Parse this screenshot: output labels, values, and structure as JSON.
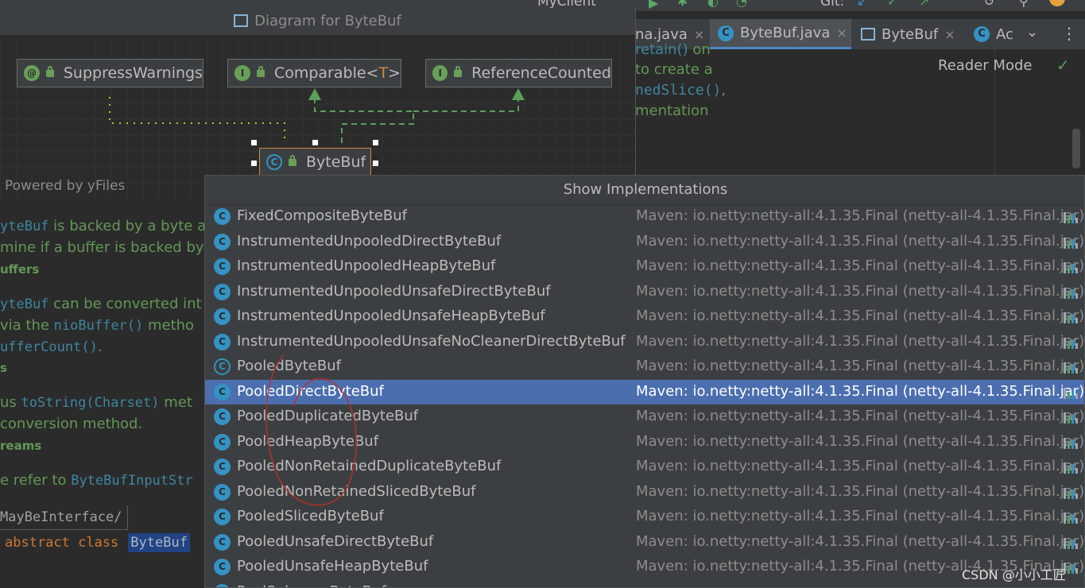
{
  "toolbar": {
    "run_config": "MyClient",
    "git_label": "Git:"
  },
  "tabs": [
    {
      "label": "na.java",
      "close": "×",
      "icon": "java-file-icon"
    },
    {
      "label": "ByteBuf.java",
      "close": "×",
      "icon": "class-icon",
      "icon_glyph": "C"
    },
    {
      "label": "ByteBuf",
      "close": "×",
      "icon": "diagram-icon"
    },
    {
      "label": "Ac",
      "icon": "class-icon",
      "icon_glyph": "C"
    }
  ],
  "editor": {
    "reader_mode": "Reader Mode",
    "lines": [
      {
        "pre": "",
        "code": "retain()",
        "post": " on"
      },
      {
        "pre": "to create a",
        "code": "",
        "post": ""
      },
      {
        "pre": "",
        "code": "nedSlice()",
        "post": ","
      },
      {
        "pre": "mentation",
        "code": "",
        "post": ""
      }
    ]
  },
  "diagram": {
    "title": "Diagram for ByteBuf",
    "powered_by": "Powered by yFiles",
    "nodes": [
      {
        "label": "SuppressWarnings",
        "glyph": "@",
        "icon": "annotation-icon"
      },
      {
        "label": "Comparable<",
        "generic": "T",
        "suffix": ">",
        "glyph": "I",
        "icon": "interface-icon"
      },
      {
        "label": "ReferenceCounted",
        "glyph": "I",
        "icon": "interface-icon"
      },
      {
        "label": "ByteBuf",
        "glyph": "C",
        "icon": "abstract-class-icon"
      }
    ]
  },
  "leftdoc": {
    "lines": [
      {
        "code": "yteBuf",
        "text": " is backed by a byte a"
      },
      {
        "code": "",
        "text": "mine if a buffer is backed by"
      },
      {
        "bold": "uffers"
      },
      {
        "code": "yteBuf",
        "text": " can be converted int"
      },
      {
        "code2_pre": " via the ",
        "code": "nioBuffer()",
        "text": " metho"
      },
      {
        "code": "ufferCount()",
        "text": "."
      },
      {
        "bold": "s"
      },
      {
        "text_pre": "us ",
        "code": "toString(Charset)",
        "text": " met"
      },
      {
        "text": " conversion method."
      },
      {
        "bold": "reams"
      },
      {
        "text_pre": "e refer to ",
        "code": "ByteBufInputStr",
        "text": ""
      }
    ],
    "annotation": "MayBeInterface/",
    "decl_kw": "abstract class",
    "decl_name": "ByteBuf"
  },
  "popup": {
    "title": "Show Implementations",
    "rows": [
      {
        "name": "FixedCompositeByteBuf",
        "location": "Maven: io.netty:netty-all:4.1.35.Final (netty-all-4.1.35.Final.jar)",
        "abstract": false,
        "selected": false
      },
      {
        "name": "InstrumentedUnpooledDirectByteBuf",
        "location": "Maven: io.netty:netty-all:4.1.35.Final (netty-all-4.1.35.Final.jar)",
        "abstract": false,
        "selected": false
      },
      {
        "name": "InstrumentedUnpooledHeapByteBuf",
        "location": "Maven: io.netty:netty-all:4.1.35.Final (netty-all-4.1.35.Final.jar)",
        "abstract": false,
        "selected": false
      },
      {
        "name": "InstrumentedUnpooledUnsafeDirectByteBuf",
        "location": "Maven: io.netty:netty-all:4.1.35.Final (netty-all-4.1.35.Final.jar)",
        "abstract": false,
        "selected": false
      },
      {
        "name": "InstrumentedUnpooledUnsafeHeapByteBuf",
        "location": "Maven: io.netty:netty-all:4.1.35.Final (netty-all-4.1.35.Final.jar)",
        "abstract": false,
        "selected": false
      },
      {
        "name": "InstrumentedUnpooledUnsafeNoCleanerDirectByteBuf",
        "location": "Maven: io.netty:netty-all:4.1.35.Final (netty-all-4.1.35.Final.jar)",
        "abstract": false,
        "selected": false
      },
      {
        "name": "PooledByteBuf",
        "location": "Maven: io.netty:netty-all:4.1.35.Final (netty-all-4.1.35.Final.jar)",
        "abstract": true,
        "selected": false
      },
      {
        "name": "PooledDirectByteBuf",
        "location": "Maven: io.netty:netty-all:4.1.35.Final (netty-all-4.1.35.Final.jar)",
        "abstract": false,
        "selected": true
      },
      {
        "name": "PooledDuplicatedByteBuf",
        "location": "Maven: io.netty:netty-all:4.1.35.Final (netty-all-4.1.35.Final.jar)",
        "abstract": false,
        "selected": false
      },
      {
        "name": "PooledHeapByteBuf",
        "location": "Maven: io.netty:netty-all:4.1.35.Final (netty-all-4.1.35.Final.jar)",
        "abstract": false,
        "selected": false
      },
      {
        "name": "PooledNonRetainedDuplicateByteBuf",
        "location": "Maven: io.netty:netty-all:4.1.35.Final (netty-all-4.1.35.Final.jar)",
        "abstract": false,
        "selected": false
      },
      {
        "name": "PooledNonRetainedSlicedByteBuf",
        "location": "Maven: io.netty:netty-all:4.1.35.Final (netty-all-4.1.35.Final.jar)",
        "abstract": false,
        "selected": false
      },
      {
        "name": "PooledSlicedByteBuf",
        "location": "Maven: io.netty:netty-all:4.1.35.Final (netty-all-4.1.35.Final.jar)",
        "abstract": false,
        "selected": false
      },
      {
        "name": "PooledUnsafeDirectByteBuf",
        "location": "Maven: io.netty:netty-all:4.1.35.Final (netty-all-4.1.35.Final.jar)",
        "abstract": false,
        "selected": false
      },
      {
        "name": "PooledUnsafeHeapByteBuf",
        "location": "Maven: io.netty:netty-all:4.1.35.Final (netty-all-4.1.35.Final.jar)",
        "abstract": false,
        "selected": false
      },
      {
        "name": "PoolSubpageByteBuf",
        "location": "",
        "abstract": false,
        "selected": false
      }
    ]
  },
  "watermark": "CSDN @小小工匠",
  "colors": {
    "selection": "#4b6eaf",
    "class_icon": "#3592c4",
    "doc_green": "#629755",
    "keyword": "#cc7832",
    "annotation_ink": "#c0302a"
  }
}
